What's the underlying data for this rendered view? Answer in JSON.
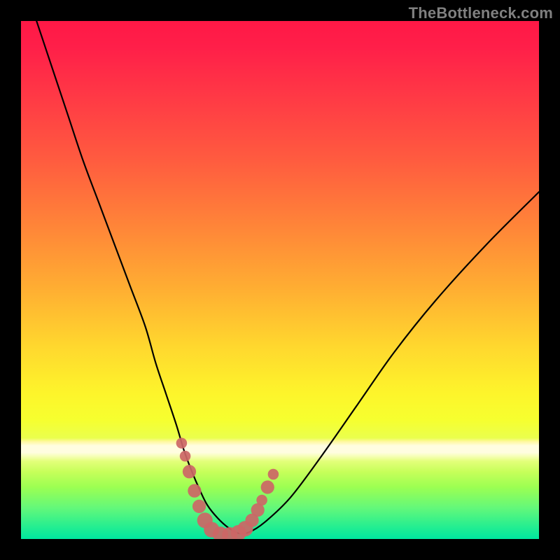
{
  "attribution": "TheBottleneck.com",
  "chart_data": {
    "type": "line",
    "title": "",
    "xlabel": "",
    "ylabel": "",
    "xlim": [
      0,
      100
    ],
    "ylim": [
      0,
      100
    ],
    "series": [
      {
        "name": "bottleneck-curve",
        "x": [
          3,
          6,
          9,
          12,
          15,
          18,
          21,
          24,
          26,
          28,
          30,
          31.5,
          33,
          34.5,
          36,
          38,
          40,
          42,
          44,
          47,
          52,
          58,
          65,
          72,
          80,
          90,
          100
        ],
        "values": [
          100,
          91,
          82,
          73,
          65,
          57,
          49,
          41,
          34,
          28,
          22,
          17,
          13,
          9.5,
          6.5,
          4,
          2.2,
          1.1,
          1.3,
          3.2,
          8,
          16,
          26,
          36,
          46,
          57,
          67
        ]
      }
    ],
    "markers": {
      "name": "valley-highlight",
      "color": "#cc6666",
      "points": [
        {
          "x": 31.0,
          "y": 18.5,
          "r": 1.05
        },
        {
          "x": 31.7,
          "y": 16.0,
          "r": 1.05
        },
        {
          "x": 32.5,
          "y": 13.0,
          "r": 1.3
        },
        {
          "x": 33.5,
          "y": 9.3,
          "r": 1.3
        },
        {
          "x": 34.4,
          "y": 6.3,
          "r": 1.3
        },
        {
          "x": 35.5,
          "y": 3.6,
          "r": 1.5
        },
        {
          "x": 36.8,
          "y": 1.8,
          "r": 1.5
        },
        {
          "x": 38.5,
          "y": 0.9,
          "r": 1.5
        },
        {
          "x": 40.3,
          "y": 0.8,
          "r": 1.5
        },
        {
          "x": 42.0,
          "y": 1.2,
          "r": 1.5
        },
        {
          "x": 43.3,
          "y": 2.0,
          "r": 1.5
        },
        {
          "x": 44.6,
          "y": 3.6,
          "r": 1.3
        },
        {
          "x": 45.7,
          "y": 5.6,
          "r": 1.3
        },
        {
          "x": 46.5,
          "y": 7.5,
          "r": 1.05
        },
        {
          "x": 47.6,
          "y": 10.0,
          "r": 1.3
        },
        {
          "x": 48.7,
          "y": 12.5,
          "r": 1.05
        }
      ]
    },
    "gradient_stops": [
      {
        "offset": 0,
        "color": "#ff1846"
      },
      {
        "offset": 0.15,
        "color": "#ff3a45"
      },
      {
        "offset": 0.4,
        "color": "#ff8638"
      },
      {
        "offset": 0.63,
        "color": "#ffd82e"
      },
      {
        "offset": 0.77,
        "color": "#f6ff2f"
      },
      {
        "offset": 0.82,
        "color": "#fffde0"
      },
      {
        "offset": 0.87,
        "color": "#c7ff5a"
      },
      {
        "offset": 0.94,
        "color": "#63f87a"
      },
      {
        "offset": 1.0,
        "color": "#00e79f"
      }
    ]
  },
  "colors": {
    "background": "#000000",
    "curve": "#000000",
    "marker_fill": "#cc6666",
    "attribution": "#808080"
  }
}
